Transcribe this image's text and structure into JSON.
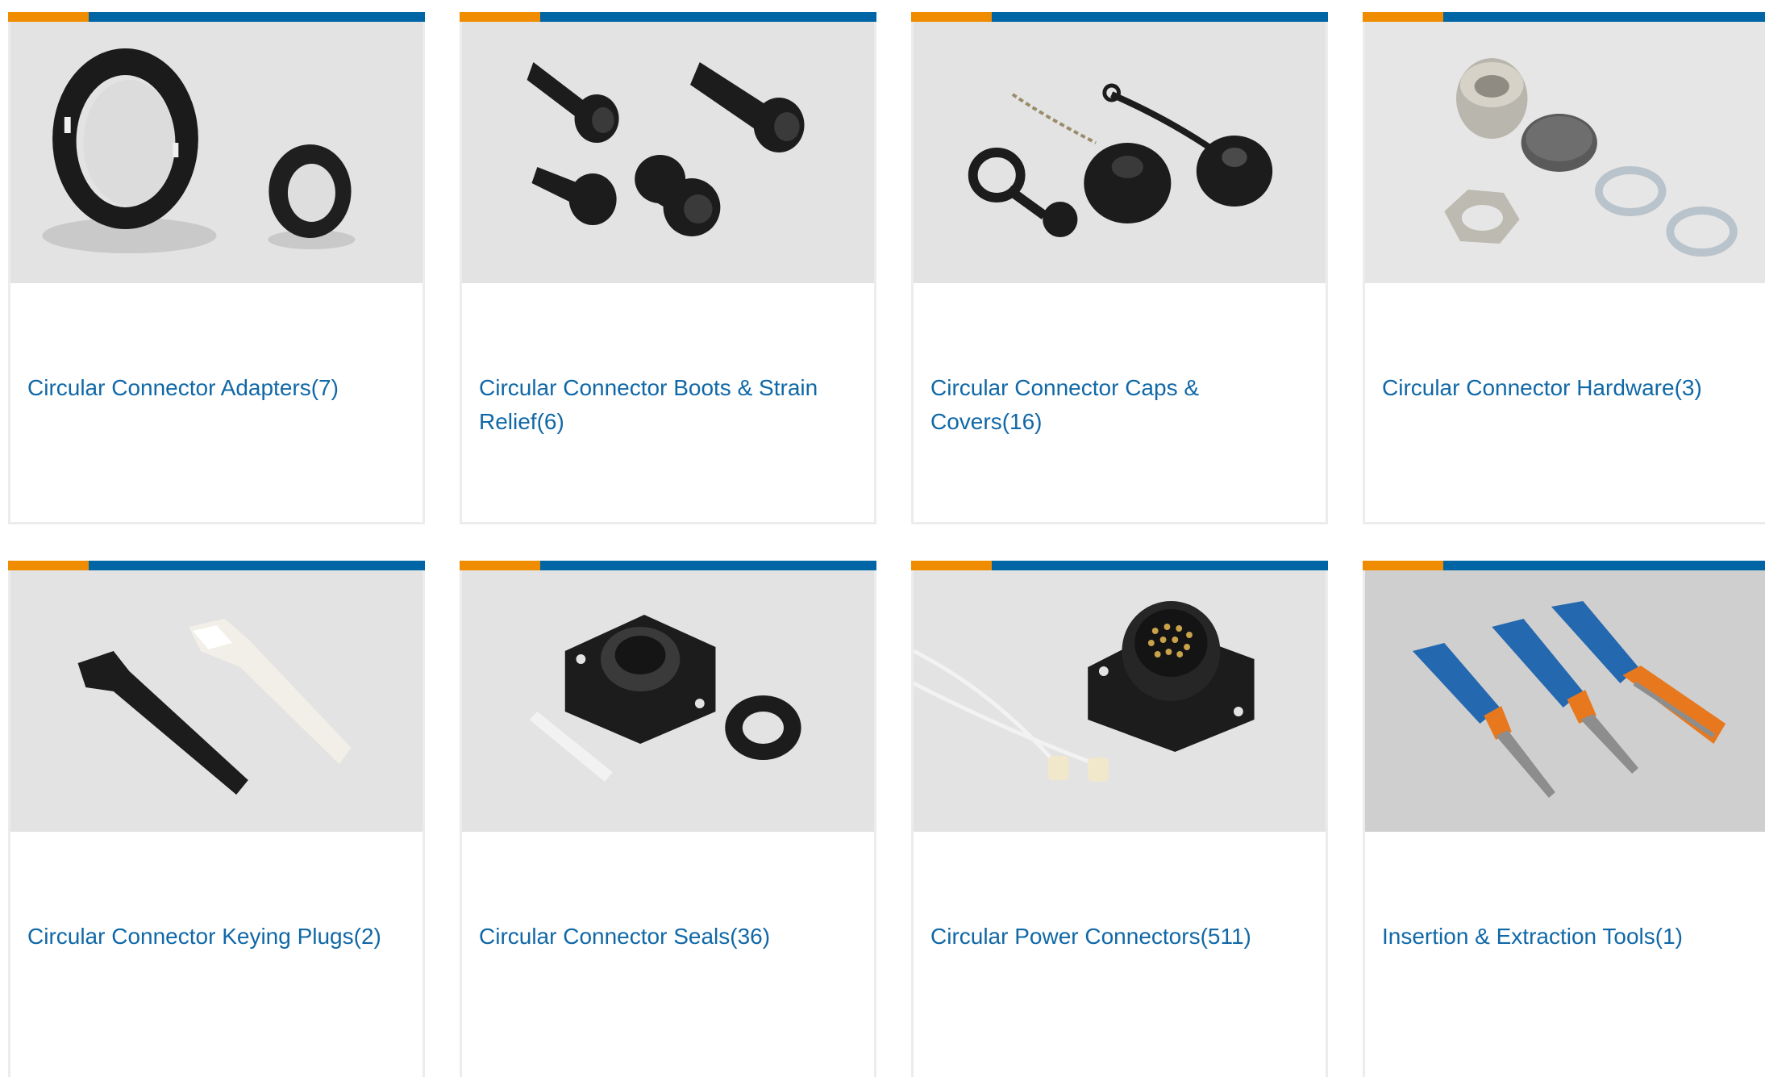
{
  "colors": {
    "accent_orange": "#f08c00",
    "accent_blue": "#0065a4",
    "link_blue": "#1068a7",
    "photo_bg": "#e2e2e2"
  },
  "categories": [
    {
      "name": "Circular Connector Adapters",
      "count": "(7)",
      "label": "Circular Connector Adapters(7)",
      "image": "adapter-rings"
    },
    {
      "name": "Circular Connector Boots & Strain Relief",
      "count": "(6)",
      "label": "Circular Connector Boots & Strain Relief(6)",
      "image": "boots-strain-relief"
    },
    {
      "name": "Circular Connector Caps & Covers",
      "count": "(16)",
      "label": "Circular Connector Caps & Covers(16)",
      "image": "caps-covers"
    },
    {
      "name": "Circular Connector Hardware",
      "count": "(3)",
      "label": "Circular Connector Hardware(3)",
      "image": "nuts-washers"
    },
    {
      "name": "Circular Connector Keying Plugs",
      "count": "(2)",
      "label": "Circular Connector Keying Plugs(2)",
      "image": "keying-plugs"
    },
    {
      "name": "Circular Connector Seals",
      "count": "(36)",
      "label": "Circular Connector Seals(36)",
      "image": "seals"
    },
    {
      "name": "Circular Power Connectors",
      "count": "(511)",
      "label": "Circular Power Connectors(511)",
      "image": "power-connector"
    },
    {
      "name": "Insertion & Extraction Tools",
      "count": "(1)",
      "label": "Insertion & Extraction Tools(1)",
      "image": "extraction-tools"
    }
  ]
}
